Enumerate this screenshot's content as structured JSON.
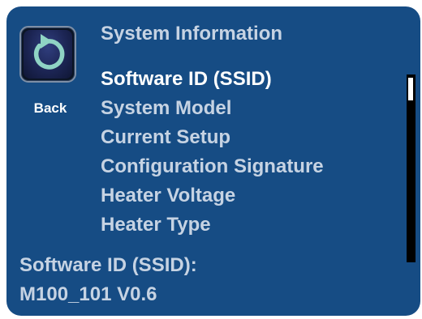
{
  "header": {
    "title": "System Information"
  },
  "back_button": {
    "label": "Back",
    "icon": "circular-arrow-back-icon"
  },
  "menu": {
    "selected_index": 0,
    "items": [
      {
        "label": "Software ID (SSID)"
      },
      {
        "label": "System Model"
      },
      {
        "label": "Current Setup"
      },
      {
        "label": "Configuration Signature"
      },
      {
        "label": "Heater Voltage"
      },
      {
        "label": "Heater Type"
      }
    ]
  },
  "detail": {
    "label": "Software ID (SSID):",
    "value": "M100_101 V0.6"
  },
  "colors": {
    "panel_background": "#164c84",
    "text": "#c6d3e3",
    "selected_text": "#ffffff",
    "icon_arrow": "#8fd3c4",
    "scrollbar_track": "#000000",
    "scrollbar_thumb": "#ffffff"
  }
}
